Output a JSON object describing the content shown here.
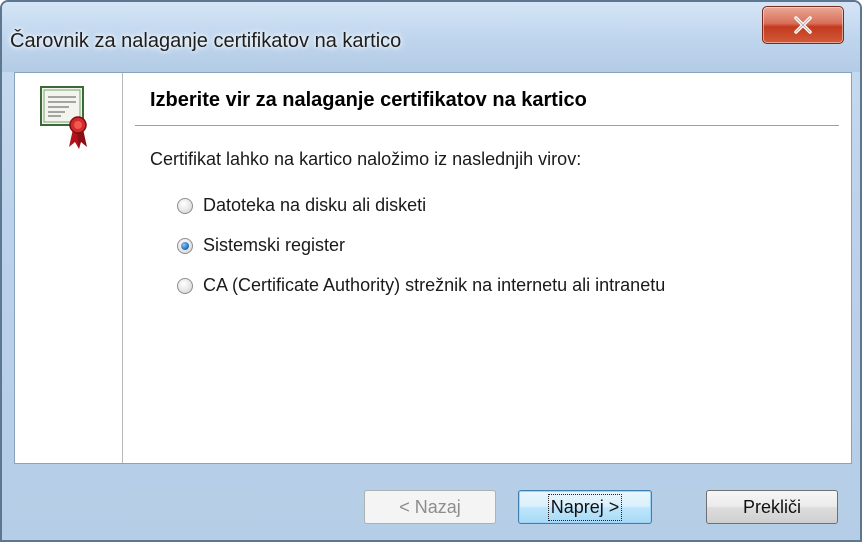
{
  "window": {
    "title": "Čarovnik za nalaganje certifikatov na kartico",
    "close_glyph": "x"
  },
  "wizard": {
    "icon": "certificate-icon",
    "heading": "Izberite vir za nalaganje certifikatov na kartico",
    "description": "Certifikat lahko na kartico naložimo iz naslednjih virov:",
    "options": [
      {
        "label": "Datoteka na disku ali disketi",
        "checked": false
      },
      {
        "label": "Sistemski register",
        "checked": true
      },
      {
        "label": "CA (Certificate Authority) strežnik na internetu ali intranetu",
        "checked": false
      }
    ]
  },
  "buttons": {
    "back": {
      "label": "< Nazaj",
      "enabled": false
    },
    "next": {
      "label": "Naprej >",
      "enabled": true
    },
    "cancel": {
      "label": "Prekliči",
      "enabled": true
    }
  },
  "colors": {
    "title_bar": "#bcd2ea",
    "close_button": "#c23a1e",
    "radio_selected": "#2a74c4"
  }
}
